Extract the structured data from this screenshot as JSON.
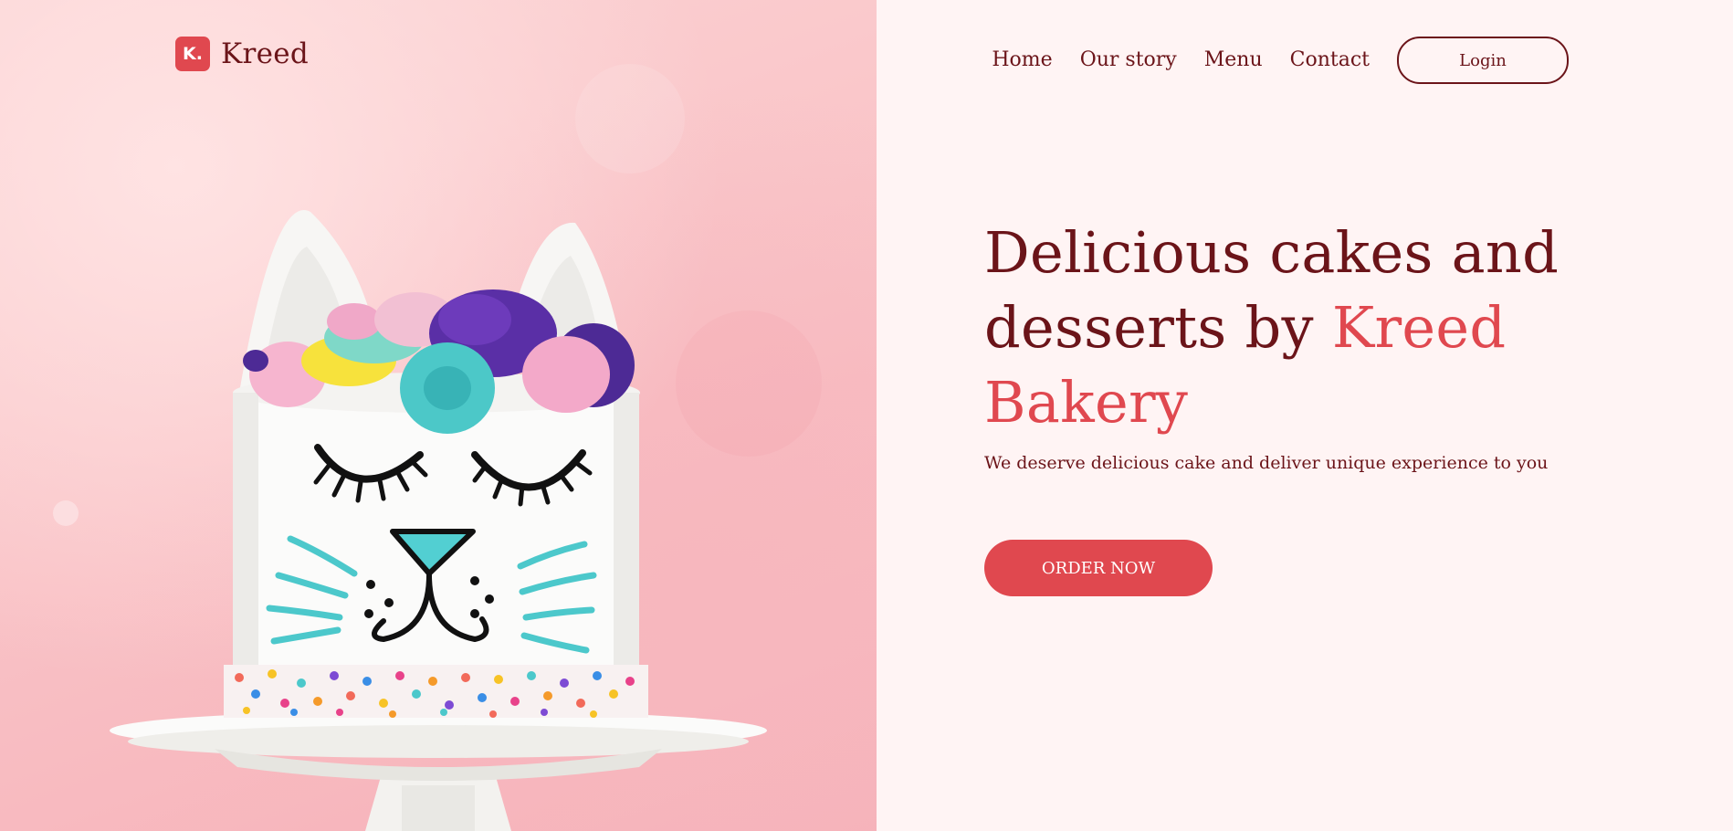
{
  "brand": {
    "logo_letter": "K.",
    "name": "Kreed",
    "accent_color": "#e0484f",
    "text_color": "#6b1419",
    "panel_background": "#fff4f4"
  },
  "nav": {
    "items": [
      {
        "label": "Home"
      },
      {
        "label": "Our story"
      },
      {
        "label": "Menu"
      },
      {
        "label": "Contact"
      }
    ],
    "login_label": "Login"
  },
  "hero": {
    "title_part1": "Delicious cakes and desserts by",
    "title_accent": "Kreed Bakery",
    "subtitle": "We deserve delicious cake and deliver unique experience to you",
    "cta_label": "ORDER NOW"
  }
}
